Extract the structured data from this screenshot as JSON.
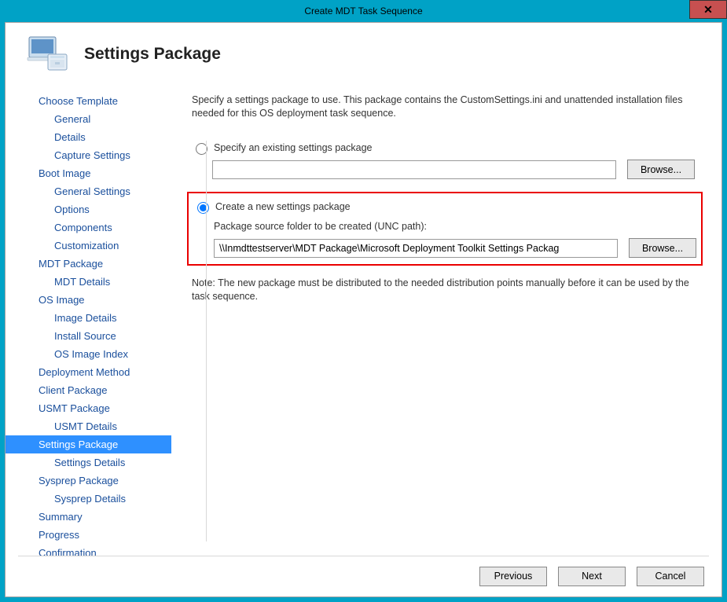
{
  "titlebar": {
    "title": "Create MDT Task Sequence"
  },
  "header": {
    "title": "Settings Package"
  },
  "sidebar": {
    "items": [
      {
        "label": "Choose Template",
        "sub": false
      },
      {
        "label": "General",
        "sub": true
      },
      {
        "label": "Details",
        "sub": true
      },
      {
        "label": "Capture Settings",
        "sub": true
      },
      {
        "label": "Boot Image",
        "sub": false
      },
      {
        "label": "General Settings",
        "sub": true
      },
      {
        "label": "Options",
        "sub": true
      },
      {
        "label": "Components",
        "sub": true
      },
      {
        "label": "Customization",
        "sub": true
      },
      {
        "label": "MDT Package",
        "sub": false
      },
      {
        "label": "MDT Details",
        "sub": true
      },
      {
        "label": "OS Image",
        "sub": false
      },
      {
        "label": "Image Details",
        "sub": true
      },
      {
        "label": "Install Source",
        "sub": true
      },
      {
        "label": "OS Image Index",
        "sub": true
      },
      {
        "label": "Deployment Method",
        "sub": false
      },
      {
        "label": "Client Package",
        "sub": false
      },
      {
        "label": "USMT Package",
        "sub": false
      },
      {
        "label": "USMT Details",
        "sub": true
      },
      {
        "label": "Settings Package",
        "sub": false,
        "selected": true
      },
      {
        "label": "Settings Details",
        "sub": true
      },
      {
        "label": "Sysprep Package",
        "sub": false
      },
      {
        "label": "Sysprep Details",
        "sub": true
      },
      {
        "label": "Summary",
        "sub": false
      },
      {
        "label": "Progress",
        "sub": false
      },
      {
        "label": "Confirmation",
        "sub": false
      }
    ]
  },
  "main": {
    "description": "Specify a settings package to use.  This package contains the CustomSettings.ini and unattended installation files needed for this OS deployment task sequence.",
    "option_existing": "Specify an existing settings package",
    "option_create": "Create a new settings package",
    "unc_label": "Package source folder to be created (UNC path):",
    "unc_value": "\\\\Inmdttestserver\\MDT Package\\Microsoft Deployment Toolkit Settings Packag",
    "browse_label": "Browse...",
    "note": "Note: The new package must be distributed to the needed distribution points manually before it can be used by the task sequence."
  },
  "footer": {
    "previous": "Previous",
    "next": "Next",
    "cancel": "Cancel"
  }
}
